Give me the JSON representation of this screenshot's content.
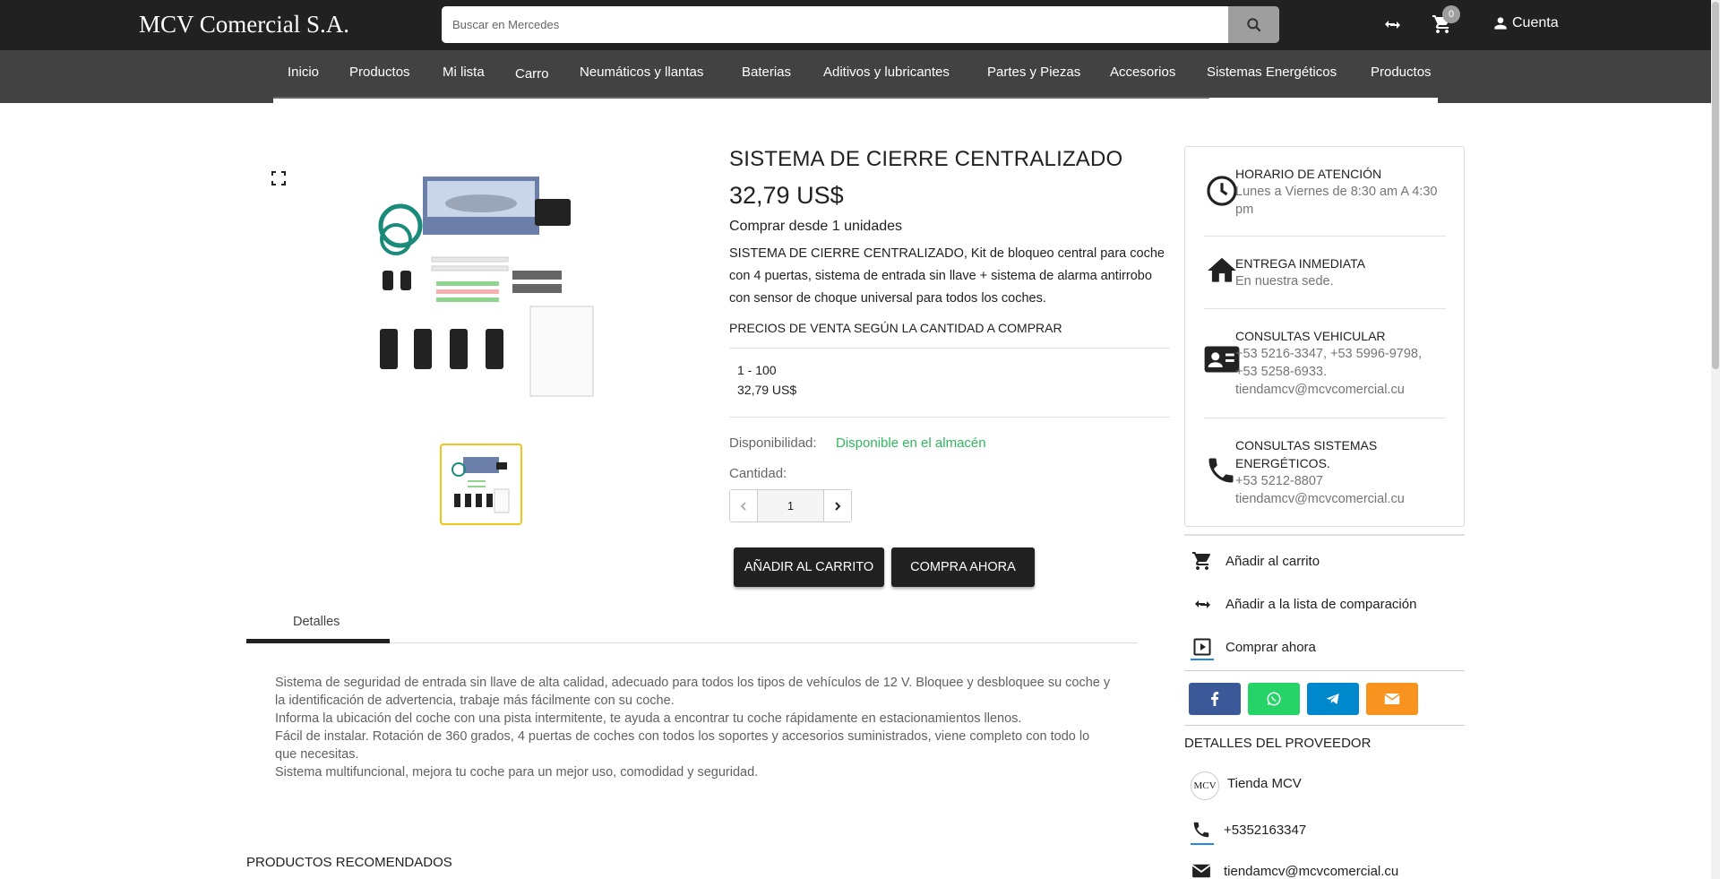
{
  "header": {
    "logo": "MCV Comercial S.A.",
    "search_placeholder": "Buscar en Mercedes",
    "cart_count": "0",
    "account_label": "Cuenta",
    "icons": [
      "search-icon",
      "compare-icon",
      "cart-icon",
      "person-icon"
    ]
  },
  "nav": {
    "items": [
      "Inicio",
      "Productos",
      "Mi lista",
      "Carro",
      "Neumáticos y llantas",
      "Baterias",
      "Aditivos y lubricantes",
      "Partes y Piezas",
      "Accesorios",
      "Sistemas Energéticos",
      "Productos"
    ]
  },
  "product": {
    "title": "SISTEMA DE CIERRE CENTRALIZADO",
    "price": "32,79 US$",
    "min_qty": "Comprar desde 1 unidades",
    "description": "SISTEMA DE CIERRE CENTRALIZADO, Kit de bloqueo central para coche con 4 puertas, sistema de entrada sin llave + sistema de alarma antirrobo con sensor de choque universal para todos los coches.",
    "tier_title": "PRECIOS DE VENTA SEGÚN LA CANTIDAD A COMPRAR",
    "tier_range": "1 - 100",
    "tier_price": "32,79 US$",
    "availability_label": "Disponibilidad:",
    "availability_value": "Disponible en el almacén",
    "quantity_label": "Cantidad:",
    "quantity_value": "1",
    "add_to_cart": "AÑADIR AL CARRITO",
    "buy_now": "COMPRA AHORA"
  },
  "tabs": {
    "active": "Detalles"
  },
  "details": {
    "lines": [
      "Sistema de seguridad de entrada sin llave de alta calidad, adecuado para todos los tipos de vehículos de 12 V. Bloquee y desbloquee su coche y la identificación de advertencia, trabaje más fácilmente con su coche.",
      "Informa la ubicación del coche con una pista intermitente, te ayuda a encontrar tu coche rápidamente en estacionamientos llenos.",
      "Fácil de instalar. Rotación de 360 grados, 4 puertas de coches con todos los soportes y accesorios suministrados, viene completo con todo lo que necesitas.",
      "Sistema multifuncional, mejora tu coche para un mejor uso, comodidad y seguridad."
    ]
  },
  "recommended_title": "PRODUCTOS RECOMENDADOS",
  "info": {
    "schedule_title": "HORARIO DE ATENCIÓN",
    "schedule_text": "Lunes a Viernes de 8:30 am A 4:30 pm",
    "delivery_title": "ENTREGA INMEDIATA",
    "delivery_text": "En nuestra sede.",
    "vehicle_title": "CONSULTAS VEHICULAR",
    "vehicle_text": "+53 5216-3347, +53 5996-9798, +53 5258-6933.",
    "vehicle_email": "tiendamcv@mcvcomercial.cu",
    "energy_title": "CONSULTAS SISTEMAS ENERGÉTICOS.",
    "energy_phone": "+53 5212-8807",
    "energy_email": "tiendamcv@mcvcomercial.cu"
  },
  "side_actions": {
    "add_cart": "Añadir al carrito",
    "compare": "Añadir a la lista de comparación",
    "buy_now": "Comprar ahora"
  },
  "share_colors": {
    "facebook": "#3b5998",
    "whatsapp": "#25d366",
    "telegram": "#0088cc",
    "email": "#f7931e"
  },
  "provider": {
    "title": "DETALLES DEL PROVEEDOR",
    "logo_text": "MCV",
    "name": "Tienda MCV",
    "phone": "+5352163347",
    "email": "tiendamcv@mcvcomercial.cu"
  }
}
